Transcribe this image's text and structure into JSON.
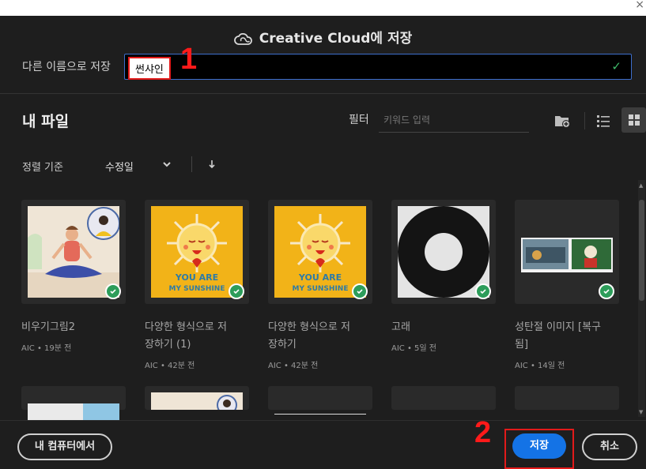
{
  "dialog": {
    "title": "Creative Cloud에 저장",
    "close_glyph": "×"
  },
  "save_as": {
    "label": "다른 이름으로 저장",
    "value": "썬샤인",
    "valid_icon": "check-icon"
  },
  "annotations": {
    "step1": "1",
    "step2": "2"
  },
  "files": {
    "heading": "내 파일",
    "filter_label": "필터",
    "search_placeholder": "키워드 입력",
    "sort_label": "정렬 기준",
    "sort_value": "수정일",
    "view_mode": "grid"
  },
  "items": [
    {
      "name_line1": "비우기그림2",
      "name_line2": "",
      "meta": "AIC • 19분 전",
      "thumb": "yoga-man"
    },
    {
      "name_line1": "다양한 형식으로 저",
      "name_line2": "장하기 (1)",
      "meta": "AIC • 42분 전",
      "thumb": "sunshine"
    },
    {
      "name_line1": "다양한 형식으로 저",
      "name_line2": "장하기",
      "meta": "AIC • 42분 전",
      "thumb": "sunshine"
    },
    {
      "name_line1": "고래",
      "name_line2": "",
      "meta": "AIC • 5일 전",
      "thumb": "ring"
    },
    {
      "name_line1": "성탄절 이미지 [복구",
      "name_line2": "됨]",
      "meta": "AIC • 14일 전",
      "thumb": "christmas"
    }
  ],
  "footer": {
    "my_computer": "내 컴퓨터에서",
    "save": "저장",
    "cancel": "취소"
  },
  "colors": {
    "background": "#1e1e1e",
    "accent": "#1473e6",
    "highlight": "#e21a1a",
    "success": "#2d9d5a"
  }
}
